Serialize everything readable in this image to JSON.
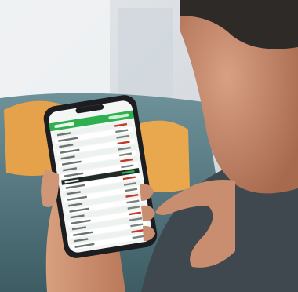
{
  "photo": {
    "subject": "phone-in-hand",
    "wall_color": "#dcdfe2",
    "sofa_color": "#5a7f88",
    "pillow_color": "#e6a24a",
    "skin_color": "#c98e70",
    "shirt_color": "#3f474f",
    "hair_color": "#2d2a28"
  },
  "phone_screen": {
    "accent_color": "#2fb04f",
    "row_count": 20,
    "highlighted_row_index": 8
  }
}
